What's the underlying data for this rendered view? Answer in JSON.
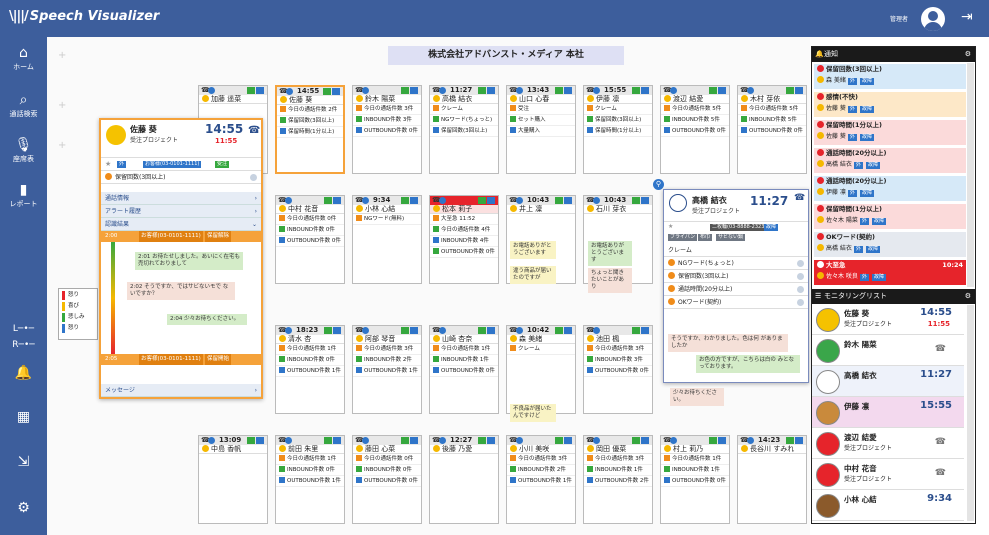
{
  "app": {
    "brand_small": "AmiVoice",
    "brand": "Speech Visualizer",
    "admin_label": "管理者"
  },
  "nav": [
    {
      "label": "ホーム",
      "icon": "home-icon"
    },
    {
      "label": "通話検索",
      "icon": "search-icon"
    },
    {
      "label": "座席表",
      "icon": "microphone-icon"
    },
    {
      "label": "レポート",
      "icon": "bar-chart-icon"
    }
  ],
  "legend": [
    "怒り",
    "喜び",
    "悲しみ",
    "怒り"
  ],
  "page_title": "株式会社アドバンスト・メディア 本社",
  "seats": [
    {
      "name": "加藤 遥菜",
      "time": "",
      "theme": "gray"
    },
    {
      "name": "佐藤 葵",
      "time": "14:55",
      "theme": "orange",
      "rows": [
        "今日の通話件数 2件",
        "保留回数(3回以上)",
        "保留時間(1分以上)"
      ]
    },
    {
      "name": "鈴木 陽菜",
      "time": "",
      "theme": "gray",
      "rows": [
        "今日の通話件数 3件",
        "INBOUND件数 3件",
        "OUTBOUND件数 0件"
      ]
    },
    {
      "name": "高橋 結衣",
      "time": "11:27",
      "theme": "gray",
      "rows": [
        "クレーム",
        "NGワード(ちょっと)",
        "保留回数(3回以上)"
      ]
    },
    {
      "name": "山口 心春",
      "time": "13:43",
      "theme": "gray",
      "rows": [
        "受注",
        "セット購入",
        "大量購入"
      ]
    },
    {
      "name": "伊藤 凛",
      "time": "15:55",
      "theme": "gray",
      "rows": [
        "クレーム",
        "保留回数(3回以上)",
        "保留時間(1分以上)"
      ]
    },
    {
      "name": "渡辺 結愛",
      "time": "",
      "theme": "gray",
      "rows": [
        "今日の通話件数 5件",
        "INBOUND件数 5件",
        "OUTBOUND件数 0件"
      ]
    },
    {
      "name": "木村 芽依",
      "time": "",
      "theme": "gray",
      "rows": [
        "今日の通話件数 5件",
        "INBOUND件数 5件",
        "OUTBOUND件数 0件"
      ]
    },
    {
      "name": "中村 花音",
      "time": "",
      "theme": "gray",
      "rows": [
        "今日の通話件数 0件",
        "INBOUND件数 0件",
        "OUTBOUND件数 0件"
      ]
    },
    {
      "name": "小林 心結",
      "time": "9:34",
      "theme": "gray",
      "rows": [
        "NGワード(無料)"
      ]
    },
    {
      "name": "松本 莉子",
      "time": "",
      "theme": "red",
      "rows": [
        "大至急 11:52",
        "今日の通話件数 4件",
        "INBOUND件数 4件",
        "OUTBOUND件数 0件"
      ]
    },
    {
      "name": "井上 凜",
      "time": "10:43",
      "theme": "gray",
      "rows": []
    },
    {
      "name": "石川 芽衣",
      "time": "10:43",
      "theme": "gray",
      "rows": []
    },
    {
      "name": "清水 杏",
      "time": "18:23",
      "theme": "gray",
      "rows": [
        "今日の通話件数 1件",
        "INBOUND件数 0件",
        "OUTBOUND件数 1件"
      ]
    },
    {
      "name": "阿部 琴音",
      "time": "",
      "theme": "gray",
      "rows": [
        "今日の通話件数 3件",
        "INBOUND件数 2件",
        "OUTBOUND件数 1件"
      ]
    },
    {
      "name": "山崎 杏奈",
      "time": "",
      "theme": "gray",
      "rows": [
        "今日の通話件数 1件",
        "INBOUND件数 1件",
        "OUTBOUND件数 0件"
      ]
    },
    {
      "name": "森 美緒",
      "time": "10:42",
      "theme": "gray",
      "rows": [
        "クレーム"
      ]
    },
    {
      "name": "池田 楓",
      "time": "",
      "theme": "gray",
      "rows": [
        "今日の通話件数 3件",
        "INBOUND件数 3件",
        "OUTBOUND件数 0件"
      ]
    },
    {
      "name": "中島 香帆",
      "time": "13:09",
      "theme": "gray",
      "rows": []
    },
    {
      "name": "前田 朱里",
      "time": "",
      "theme": "gray",
      "rows": [
        "今日の通話件数 1件",
        "INBOUND件数 0件",
        "OUTBOUND件数 1件"
      ]
    },
    {
      "name": "藤田 心菜",
      "time": "",
      "theme": "gray",
      "rows": [
        "今日の通話件数 0件",
        "INBOUND件数 0件",
        "OUTBOUND件数 0件"
      ]
    },
    {
      "name": "後藤 乃愛",
      "time": "12:27",
      "theme": "gray",
      "rows": []
    },
    {
      "name": "小川 美咲",
      "time": "",
      "theme": "gray",
      "rows": [
        "今日の通話件数 3件",
        "INBOUND件数 2件",
        "OUTBOUND件数 1件"
      ]
    },
    {
      "name": "岡田 優菜",
      "time": "",
      "theme": "gray",
      "rows": [
        "今日の通話件数 3件",
        "INBOUND件数 1件",
        "OUTBOUND件数 2件"
      ]
    },
    {
      "name": "村上 莉乃",
      "time": "",
      "theme": "gray",
      "rows": [
        "今日の通話件数 1件",
        "INBOUND件数 1件",
        "OUTBOUND件数 0件"
      ]
    },
    {
      "name": "長谷川 すみれ",
      "time": "14:23",
      "theme": "gray",
      "rows": []
    }
  ],
  "popup_sato": {
    "name": "佐藤 葵",
    "project": "受注プロジェクト",
    "time": "14:55",
    "subtime": "11:55",
    "phone_label": "お客様(03-0101-1111)",
    "alert": "保留回数(3回以上)",
    "sections": [
      "通話情報",
      "アラート履歴",
      "認識結果"
    ],
    "rec_time": "2:00",
    "rec_phone": "お客様(03-0101-1111)",
    "rec_status": "保留解除",
    "bubbles": [
      "2:01 お待たせしました。あいにく在宅も売切れておりまして",
      "2:02 そうですか、ではサビないモで ないですか？",
      "2:04 少々お待ちください。"
    ],
    "footer_time": "2:05",
    "footer_phone": "お客様(03-0101-1111)",
    "footer_status": "保留開始",
    "message_label": "メッセージ"
  },
  "popup_takahashi": {
    "name": "高橋 結衣",
    "project": "受注プロジェクト",
    "time": "11:27",
    "phone": "二枚輪(03-8888-2323)",
    "tags": [
      "フライパン",
      "布巾",
      "サビない鍋"
    ],
    "claim": "クレーム",
    "alerts": [
      "NGワード(ちょっと)",
      "保留回数(3回以上)",
      "通話時間(20分以上)",
      "OKワード(契約)"
    ],
    "bubble1": "そうですか、わかりました。色は何 がありましたか",
    "bubble2": "お色の方ですが、こちらは白の みとなっております。"
  },
  "notify": {
    "title": "通知",
    "items": [
      {
        "t1": "保留回数(3回以上)",
        "t2": "森 美緒",
        "color": "#d6e9f8"
      },
      {
        "t1": "感情(不快)",
        "t2": "佐藤 葵",
        "color": "#fde8c8"
      },
      {
        "t1": "保留時間(1分以上)",
        "t2": "佐藤 葵",
        "color": "#fbdada"
      },
      {
        "t1": "通話時間(20分以上)",
        "t2": "高橋 結衣",
        "color": "#fbdada"
      },
      {
        "t1": "通話時間(20分以上)",
        "t2": "伊藤 凛",
        "color": "#d6e9f8"
      },
      {
        "t1": "保留時間(1分以上)",
        "t2": "佐々木 陽菜",
        "color": "#fbdada"
      },
      {
        "t1": "OKワード(契約)",
        "t2": "高橋 結衣",
        "color": "#e5e9ef"
      },
      {
        "t1": "大至急",
        "t2": "佐々木 咲良",
        "time": "10:24",
        "color": "#e6242b"
      }
    ]
  },
  "monitor": {
    "title": "モニタリングリスト",
    "items": [
      {
        "name": "佐藤 葵",
        "sub": "受注プロジェクト",
        "time": "14:55",
        "subtime": "11:55",
        "avatar": "duck"
      },
      {
        "name": "鈴木 陽菜",
        "sub": "",
        "time": "",
        "avatar": "frog"
      },
      {
        "name": "高橋 結衣",
        "sub": "",
        "time": "11:27",
        "avatar": "person"
      },
      {
        "name": "伊藤 凛",
        "sub": "",
        "time": "15:55",
        "avatar": "dog"
      },
      {
        "name": "渡辺 結愛",
        "sub": "受注プロジェクト",
        "time": "",
        "avatar": "melon"
      },
      {
        "name": "中村 花音",
        "sub": "受注プロジェクト",
        "time": "",
        "avatar": "apple"
      },
      {
        "name": "小林 心結",
        "sub": "",
        "time": "9:34",
        "avatar": "donut"
      }
    ]
  },
  "colors": {
    "nav": "#3d5e9c",
    "orange": "#f5a23a",
    "red": "#e6242b",
    "blue": "#2f75c9",
    "green": "#36a83e"
  }
}
